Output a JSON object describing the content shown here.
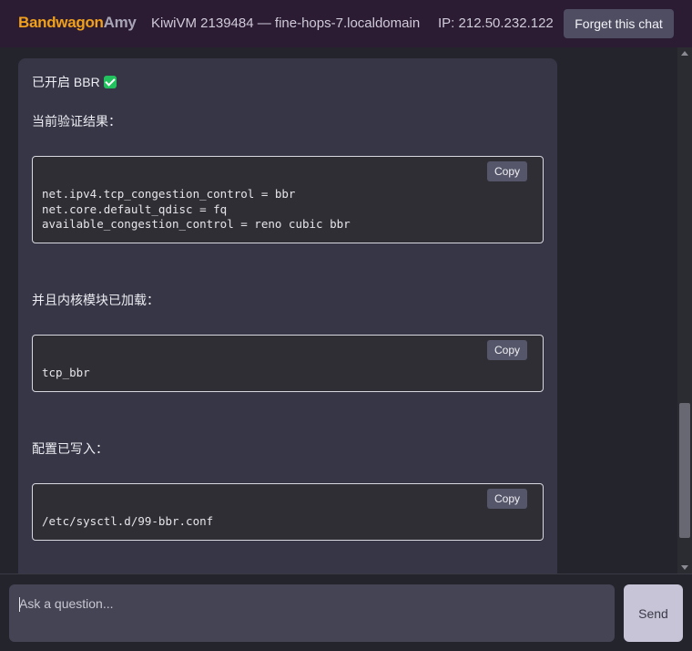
{
  "header": {
    "brand_part1": "Bandwagon",
    "brand_part2": "Amy",
    "vm_info": "KiwiVM 2139484 — fine-hops-7.localdomain",
    "ip_info": "IP: 212.50.232.122",
    "forget_label": "Forget this chat"
  },
  "message": {
    "bbr_status": "已开启 BBR",
    "check_icon": "check-icon",
    "check_color": "#22c35e",
    "verify_heading": "当前验证结果：",
    "code1": {
      "copy_label": "Copy",
      "lines": [
        "net.ipv4.tcp_congestion_control = bbr",
        "net.core.default_qdisc = fq",
        "available_congestion_control = reno cubic bbr"
      ]
    },
    "module_heading": "并且内核模块已加载：",
    "code2": {
      "copy_label": "Copy",
      "lines": [
        "tcp_bbr"
      ]
    },
    "config_heading": "配置已写入：",
    "code3": {
      "copy_label": "Copy",
      "lines": [
        "/etc/sysctl.d/99-bbr.conf"
      ]
    }
  },
  "footer": {
    "input_placeholder": "Ask a question...",
    "input_value": "",
    "send_label": "Send"
  },
  "colors": {
    "brand_accent": "#f0a01a",
    "header_bg": "#2b1b33",
    "bubble_bg": "#363646"
  }
}
